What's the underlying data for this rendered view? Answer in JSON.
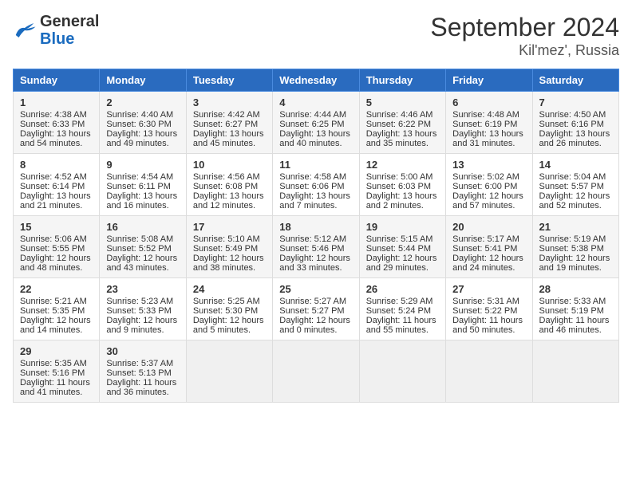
{
  "app": {
    "logo_general": "General",
    "logo_blue": "Blue",
    "title": "September 2024",
    "subtitle": "Kil'mez', Russia"
  },
  "days_of_week": [
    "Sunday",
    "Monday",
    "Tuesday",
    "Wednesday",
    "Thursday",
    "Friday",
    "Saturday"
  ],
  "weeks": [
    [
      {
        "day": "1",
        "lines": [
          "Sunrise: 4:38 AM",
          "Sunset: 6:33 PM",
          "Daylight: 13 hours",
          "and 54 minutes."
        ]
      },
      {
        "day": "2",
        "lines": [
          "Sunrise: 4:40 AM",
          "Sunset: 6:30 PM",
          "Daylight: 13 hours",
          "and 49 minutes."
        ]
      },
      {
        "day": "3",
        "lines": [
          "Sunrise: 4:42 AM",
          "Sunset: 6:27 PM",
          "Daylight: 13 hours",
          "and 45 minutes."
        ]
      },
      {
        "day": "4",
        "lines": [
          "Sunrise: 4:44 AM",
          "Sunset: 6:25 PM",
          "Daylight: 13 hours",
          "and 40 minutes."
        ]
      },
      {
        "day": "5",
        "lines": [
          "Sunrise: 4:46 AM",
          "Sunset: 6:22 PM",
          "Daylight: 13 hours",
          "and 35 minutes."
        ]
      },
      {
        "day": "6",
        "lines": [
          "Sunrise: 4:48 AM",
          "Sunset: 6:19 PM",
          "Daylight: 13 hours",
          "and 31 minutes."
        ]
      },
      {
        "day": "7",
        "lines": [
          "Sunrise: 4:50 AM",
          "Sunset: 6:16 PM",
          "Daylight: 13 hours",
          "and 26 minutes."
        ]
      }
    ],
    [
      {
        "day": "8",
        "lines": [
          "Sunrise: 4:52 AM",
          "Sunset: 6:14 PM",
          "Daylight: 13 hours",
          "and 21 minutes."
        ]
      },
      {
        "day": "9",
        "lines": [
          "Sunrise: 4:54 AM",
          "Sunset: 6:11 PM",
          "Daylight: 13 hours",
          "and 16 minutes."
        ]
      },
      {
        "day": "10",
        "lines": [
          "Sunrise: 4:56 AM",
          "Sunset: 6:08 PM",
          "Daylight: 13 hours",
          "and 12 minutes."
        ]
      },
      {
        "day": "11",
        "lines": [
          "Sunrise: 4:58 AM",
          "Sunset: 6:06 PM",
          "Daylight: 13 hours",
          "and 7 minutes."
        ]
      },
      {
        "day": "12",
        "lines": [
          "Sunrise: 5:00 AM",
          "Sunset: 6:03 PM",
          "Daylight: 13 hours",
          "and 2 minutes."
        ]
      },
      {
        "day": "13",
        "lines": [
          "Sunrise: 5:02 AM",
          "Sunset: 6:00 PM",
          "Daylight: 12 hours",
          "and 57 minutes."
        ]
      },
      {
        "day": "14",
        "lines": [
          "Sunrise: 5:04 AM",
          "Sunset: 5:57 PM",
          "Daylight: 12 hours",
          "and 52 minutes."
        ]
      }
    ],
    [
      {
        "day": "15",
        "lines": [
          "Sunrise: 5:06 AM",
          "Sunset: 5:55 PM",
          "Daylight: 12 hours",
          "and 48 minutes."
        ]
      },
      {
        "day": "16",
        "lines": [
          "Sunrise: 5:08 AM",
          "Sunset: 5:52 PM",
          "Daylight: 12 hours",
          "and 43 minutes."
        ]
      },
      {
        "day": "17",
        "lines": [
          "Sunrise: 5:10 AM",
          "Sunset: 5:49 PM",
          "Daylight: 12 hours",
          "and 38 minutes."
        ]
      },
      {
        "day": "18",
        "lines": [
          "Sunrise: 5:12 AM",
          "Sunset: 5:46 PM",
          "Daylight: 12 hours",
          "and 33 minutes."
        ]
      },
      {
        "day": "19",
        "lines": [
          "Sunrise: 5:15 AM",
          "Sunset: 5:44 PM",
          "Daylight: 12 hours",
          "and 29 minutes."
        ]
      },
      {
        "day": "20",
        "lines": [
          "Sunrise: 5:17 AM",
          "Sunset: 5:41 PM",
          "Daylight: 12 hours",
          "and 24 minutes."
        ]
      },
      {
        "day": "21",
        "lines": [
          "Sunrise: 5:19 AM",
          "Sunset: 5:38 PM",
          "Daylight: 12 hours",
          "and 19 minutes."
        ]
      }
    ],
    [
      {
        "day": "22",
        "lines": [
          "Sunrise: 5:21 AM",
          "Sunset: 5:35 PM",
          "Daylight: 12 hours",
          "and 14 minutes."
        ]
      },
      {
        "day": "23",
        "lines": [
          "Sunrise: 5:23 AM",
          "Sunset: 5:33 PM",
          "Daylight: 12 hours",
          "and 9 minutes."
        ]
      },
      {
        "day": "24",
        "lines": [
          "Sunrise: 5:25 AM",
          "Sunset: 5:30 PM",
          "Daylight: 12 hours",
          "and 5 minutes."
        ]
      },
      {
        "day": "25",
        "lines": [
          "Sunrise: 5:27 AM",
          "Sunset: 5:27 PM",
          "Daylight: 12 hours",
          "and 0 minutes."
        ]
      },
      {
        "day": "26",
        "lines": [
          "Sunrise: 5:29 AM",
          "Sunset: 5:24 PM",
          "Daylight: 11 hours",
          "and 55 minutes."
        ]
      },
      {
        "day": "27",
        "lines": [
          "Sunrise: 5:31 AM",
          "Sunset: 5:22 PM",
          "Daylight: 11 hours",
          "and 50 minutes."
        ]
      },
      {
        "day": "28",
        "lines": [
          "Sunrise: 5:33 AM",
          "Sunset: 5:19 PM",
          "Daylight: 11 hours",
          "and 46 minutes."
        ]
      }
    ],
    [
      {
        "day": "29",
        "lines": [
          "Sunrise: 5:35 AM",
          "Sunset: 5:16 PM",
          "Daylight: 11 hours",
          "and 41 minutes."
        ]
      },
      {
        "day": "30",
        "lines": [
          "Sunrise: 5:37 AM",
          "Sunset: 5:13 PM",
          "Daylight: 11 hours",
          "and 36 minutes."
        ]
      },
      {
        "day": "",
        "lines": []
      },
      {
        "day": "",
        "lines": []
      },
      {
        "day": "",
        "lines": []
      },
      {
        "day": "",
        "lines": []
      },
      {
        "day": "",
        "lines": []
      }
    ]
  ]
}
